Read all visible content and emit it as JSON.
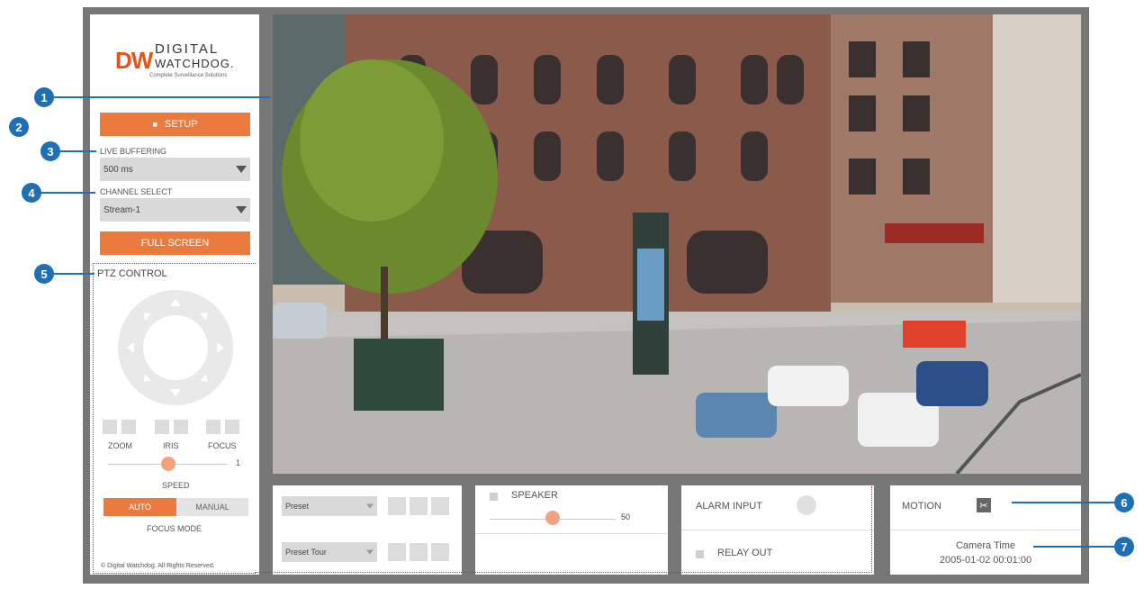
{
  "logo": {
    "mark": "DW",
    "line1": "DIGITAL",
    "line2": "WATCHDOG.",
    "tagline": "Complete Surveillance Solutions"
  },
  "sidebar": {
    "setup_label": "SETUP",
    "live_buffering": {
      "label": "LIVE BUFFERING",
      "value": "500 ms"
    },
    "channel_select": {
      "label": "CHANNEL SELECT",
      "value": "Stream-1"
    },
    "fullscreen_label": "FULL SCREEN",
    "ptz": {
      "title": "PTZ CONTROL",
      "zoom_label": "ZOOM",
      "iris_label": "IRIS",
      "focus_label": "FOCUS",
      "speed_value": "1",
      "speed_label": "SPEED",
      "focus_mode": {
        "auto": "AUTO",
        "manual": "MANUAL",
        "label": "FOCUS MODE"
      }
    },
    "copyright": "© Digital Watchdog. All Rights Reserved."
  },
  "video": {
    "scene": "street-camera-feed"
  },
  "bottom": {
    "preset": {
      "preset_placeholder": "Preset",
      "tour_placeholder": "Preset Tour"
    },
    "speaker": {
      "label": "SPEAKER",
      "value": "50"
    },
    "alarm": {
      "alarm_label": "ALARM INPUT",
      "relay_label": "RELAY OUT"
    },
    "status": {
      "motion_label": "MOTION",
      "camera_time_label": "Camera Time",
      "camera_time_value": "2005-01-02 00:01:00"
    }
  },
  "callouts": [
    "1",
    "2",
    "3",
    "4",
    "5",
    "6",
    "7"
  ],
  "colors": {
    "accent": "#ea7a3e",
    "callout": "#1f6fb5",
    "frame": "#777777",
    "dotted": "#a62a8f"
  }
}
